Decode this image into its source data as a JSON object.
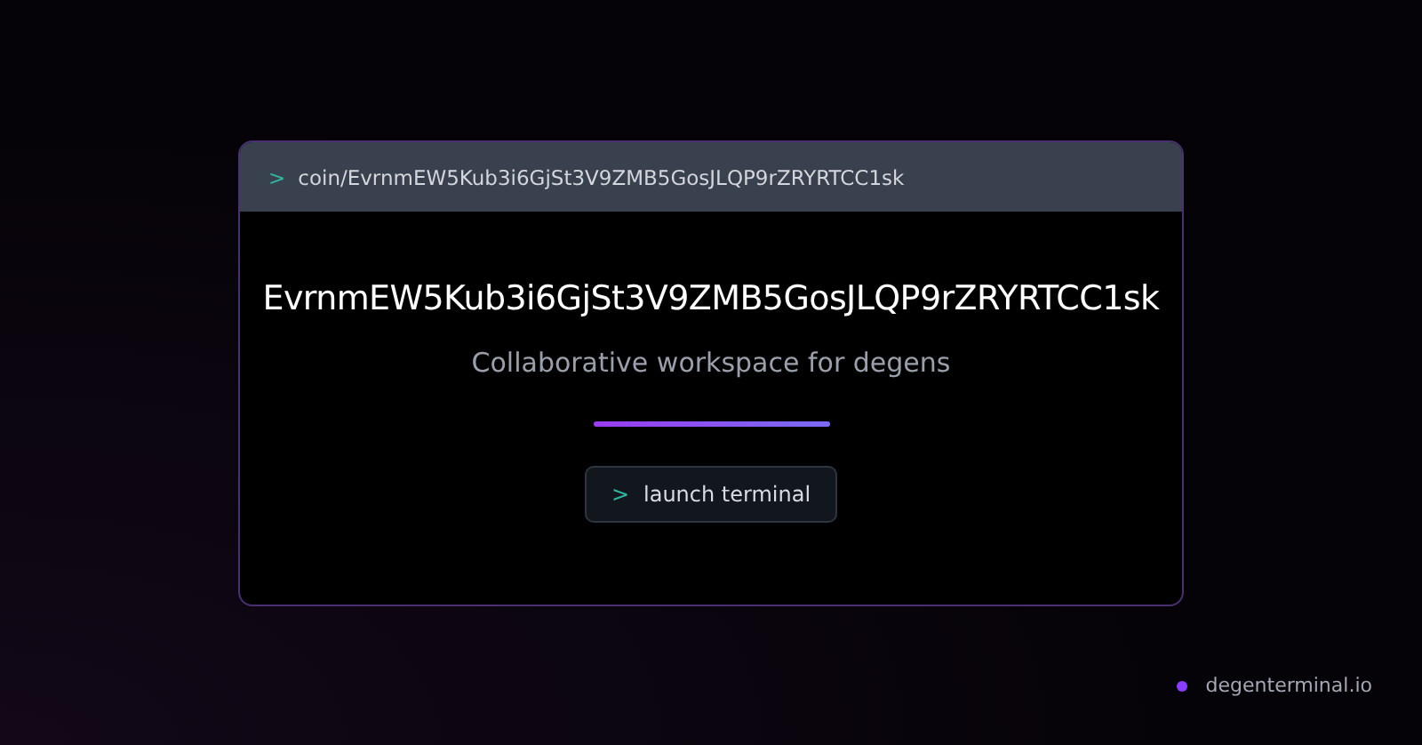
{
  "card": {
    "prompt": ">",
    "path": "coin/EvrnmEW5Kub3i6GjSt3V9ZMB5GosJLQP9rZRYRTCC1sk",
    "title": "EvrnmEW5Kub3i6GjSt3V9ZMB5GosJLQP9rZRYRTCC1sk",
    "subtitle": "Collaborative workspace for degens",
    "button": {
      "prompt": ">",
      "label": "launch terminal"
    }
  },
  "footer": {
    "site": "degenterminal.io"
  }
}
